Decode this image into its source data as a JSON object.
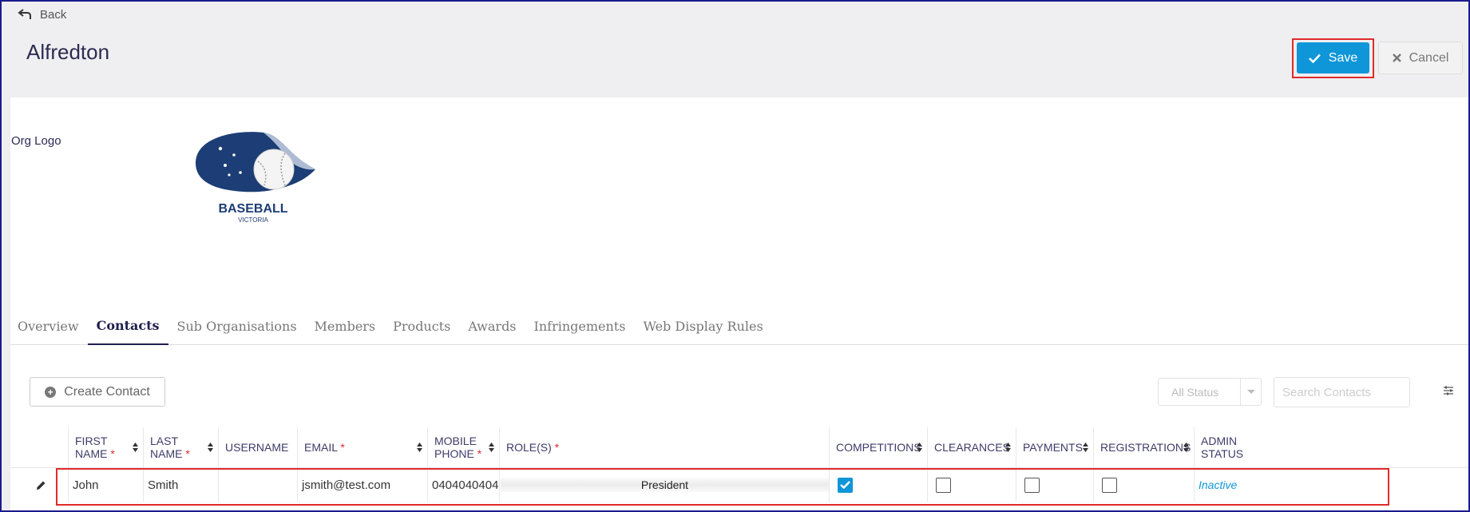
{
  "header": {
    "back_label": "Back",
    "title": "Alfredton",
    "save_label": "Save",
    "cancel_label": "Cancel"
  },
  "org": {
    "logo_label": "Org Logo",
    "logo_text_main": "BASEBALL",
    "logo_text_sub": "VICTORIA"
  },
  "tabs": [
    {
      "label": "Overview"
    },
    {
      "label": "Contacts",
      "active": true
    },
    {
      "label": "Sub Organisations"
    },
    {
      "label": "Members"
    },
    {
      "label": "Products"
    },
    {
      "label": "Awards"
    },
    {
      "label": "Infringements"
    },
    {
      "label": "Web Display Rules"
    }
  ],
  "toolbar": {
    "create_label": "Create Contact",
    "status_value": "All Status",
    "search_placeholder": "Search Contacts"
  },
  "table": {
    "columns": [
      {
        "line1": "FIRST",
        "line2": "NAME",
        "required": "*"
      },
      {
        "line1": "LAST",
        "line2": "NAME",
        "required": "*"
      },
      {
        "line1": "USERNAME"
      },
      {
        "line1": "EMAIL",
        "required": "*"
      },
      {
        "line1": "MOBILE",
        "line2": "PHONE",
        "required": "*"
      },
      {
        "line1": "ROLE(S)",
        "required": "*"
      },
      {
        "line1": "COMPETITIONS"
      },
      {
        "line1": "CLEARANCES"
      },
      {
        "line1": "PAYMENTS"
      },
      {
        "line1": "REGISTRATIONS"
      },
      {
        "line1": "ADMIN",
        "line2": "STATUS"
      }
    ],
    "rows": [
      {
        "first_name": "John",
        "last_name": "Smith",
        "username": "",
        "email": "jsmith@test.com",
        "mobile": "0404040404",
        "role": "President",
        "competitions": true,
        "clearances": false,
        "payments": false,
        "registrations": false,
        "admin_status": "Inactive"
      }
    ]
  },
  "colors": {
    "accent": "#0f96d9",
    "highlight": "#e02b2b",
    "title": "#2b2b52"
  }
}
